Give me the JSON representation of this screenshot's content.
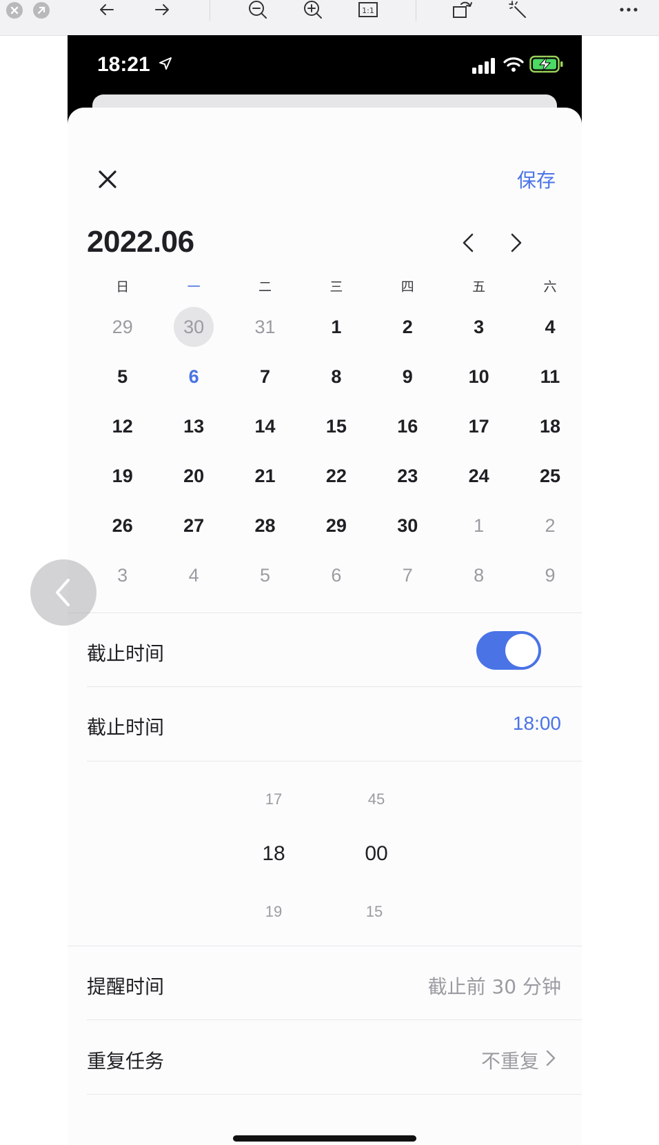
{
  "viewer": {
    "icons": [
      "close-circle-icon",
      "minimize-circle-icon",
      "back-arrow-icon",
      "forward-arrow-icon",
      "zoom-out-icon",
      "zoom-in-icon",
      "actual-size-icon",
      "rotate-icon",
      "magic-wand-icon",
      "more-icon"
    ],
    "actual_size_label": "1:1"
  },
  "status": {
    "time": "18:21"
  },
  "sheet": {
    "save_label": "保存",
    "month_title": "2022.06",
    "weekdays": [
      "日",
      "一",
      "二",
      "三",
      "四",
      "五",
      "六"
    ],
    "weeks": [
      [
        "29",
        "30",
        "31",
        "1",
        "2",
        "3",
        "4"
      ],
      [
        "5",
        "6",
        "7",
        "8",
        "9",
        "10",
        "11"
      ],
      [
        "12",
        "13",
        "14",
        "15",
        "16",
        "17",
        "18"
      ],
      [
        "19",
        "20",
        "21",
        "22",
        "23",
        "24",
        "25"
      ],
      [
        "26",
        "27",
        "28",
        "29",
        "30",
        "1",
        "2"
      ],
      [
        "3",
        "4",
        "5",
        "6",
        "7",
        "8",
        "9"
      ]
    ],
    "deadline_toggle_label": "截止时间",
    "deadline_toggle_on": true,
    "deadline_time_label": "截止时间",
    "deadline_time_value": "18:00",
    "picker": {
      "hour_prev": "17",
      "hour": "18",
      "hour_next": "19",
      "minute_prev": "45",
      "minute": "00",
      "minute_next": "15"
    },
    "reminder_label": "提醒时间",
    "reminder_value": "截止前 30 分钟",
    "repeat_label": "重复任务",
    "repeat_value": "不重复"
  },
  "colors": {
    "accent": "#4a73e6",
    "muted": "#9b9ba1",
    "text": "#1f1f24"
  }
}
